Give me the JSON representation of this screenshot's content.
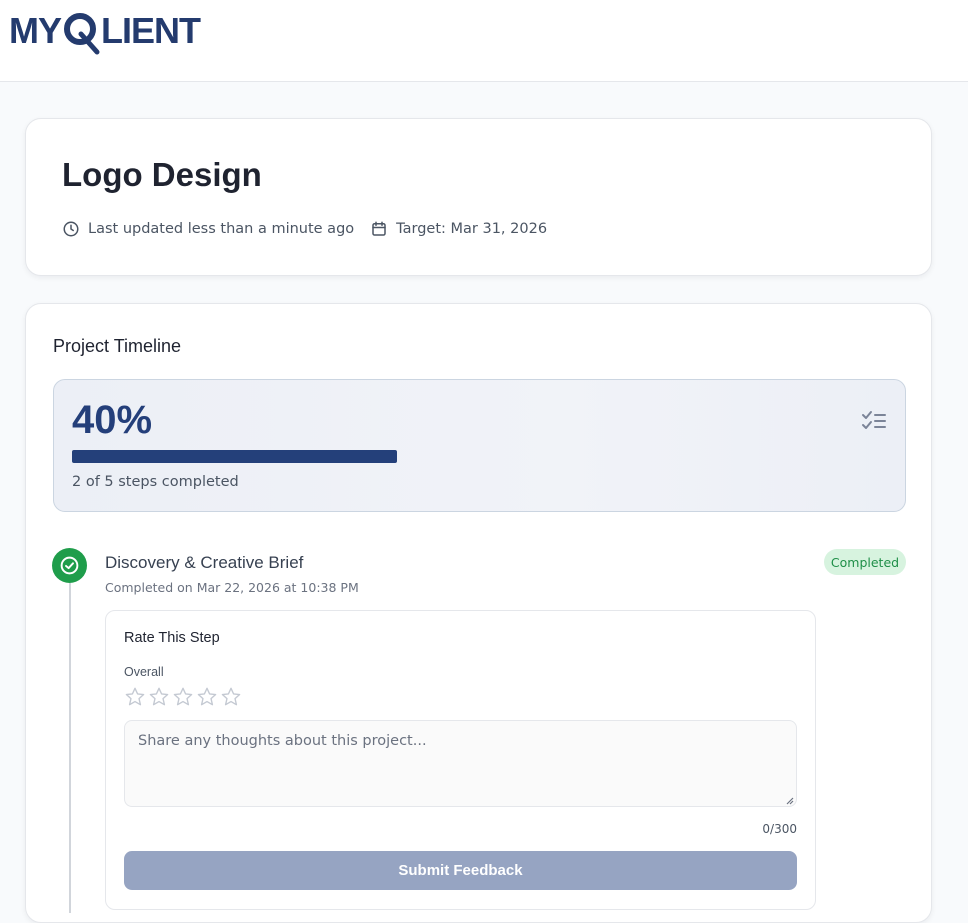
{
  "brand": {
    "logo_text_left": "MY",
    "logo_text_right": "LIENT",
    "logo_color": "#243b6e"
  },
  "project": {
    "title": "Logo Design",
    "last_updated": "Last updated less than a minute ago",
    "target": "Target: Mar 31, 2026",
    "last_updated_icon": "clock-icon",
    "target_icon": "calendar-icon"
  },
  "timeline": {
    "section_title": "Project Timeline",
    "progress_percent_label": "40%",
    "progress_fraction": 0.4,
    "steps_completed_text": "2 of 5 steps completed",
    "progress_color": "#24407a",
    "checklist_icon": "checklist-icon",
    "steps": [
      {
        "title": "Discovery & Creative Brief",
        "completed_on": "Completed on Mar 22, 2026 at 10:38 PM",
        "status": "Completed",
        "status_color": "#1f8f48",
        "icon": "check-circle-icon",
        "rating": {
          "title": "Rate This Step",
          "overall_label": "Overall",
          "stars_total": 5,
          "stars_selected": 0,
          "placeholder": "Share any thoughts about this project...",
          "char_count": "0/300",
          "submit_label": "Submit Feedback"
        }
      }
    ]
  }
}
